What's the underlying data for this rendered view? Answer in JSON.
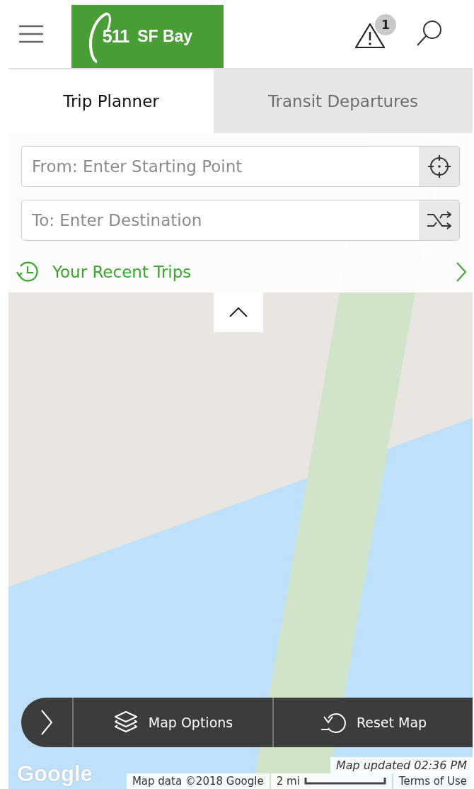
{
  "header": {
    "logo": {
      "number": "511",
      "name": "SF Bay"
    },
    "alerts": {
      "count": "1"
    }
  },
  "tabs": [
    {
      "label": "Trip Planner",
      "selected": true
    },
    {
      "label": "Transit Departures",
      "selected": false
    }
  ],
  "planner": {
    "from": {
      "placeholder": "From: Enter Starting Point"
    },
    "to": {
      "placeholder": "To: Enter Destination"
    },
    "recent_trips": "Your Recent Trips"
  },
  "map": {
    "toolbar": [
      {
        "kind": "layers",
        "label": "Map Options"
      },
      {
        "kind": "reset",
        "label": "Reset Map"
      }
    ],
    "google_logo": "Google",
    "updated": "Map updated 02:36 PM",
    "attribution": "Map data ©2018 Google",
    "scale": "2 mi",
    "terms": "Terms of Use"
  }
}
